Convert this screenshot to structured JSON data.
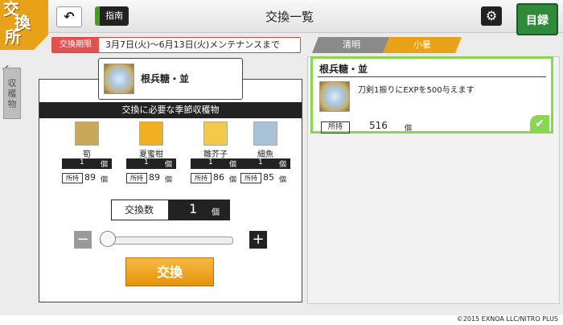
{
  "header": {
    "logo_chars": [
      "交",
      "換",
      "所"
    ],
    "guide_label": "指南",
    "title": "交換一覧",
    "catalog_label": "目録"
  },
  "period": {
    "label": "交換期限",
    "text": "3月7日(火)～6月13日(火)メンテナンスまで"
  },
  "side_tab": {
    "chars": [
      "収",
      "穫",
      "物"
    ]
  },
  "selected": {
    "name": "根兵糖・並",
    "required_header": "交換に必要な季節収穫物"
  },
  "materials": [
    {
      "name": "筍",
      "count": "1",
      "unit": "個",
      "own_label": "所持",
      "own": "89",
      "own_unit": "個",
      "icon_color": "#c9a85a"
    },
    {
      "name": "夏蜜柑",
      "count": "1",
      "unit": "個",
      "own_label": "所持",
      "own": "89",
      "own_unit": "個",
      "icon_color": "#f0b020"
    },
    {
      "name": "雛芥子",
      "count": "1",
      "unit": "個",
      "own_label": "所持",
      "own": "86",
      "own_unit": "個",
      "icon_color": "#f2c94a"
    },
    {
      "name": "細魚",
      "count": "1",
      "unit": "個",
      "own_label": "所持",
      "own": "85",
      "own_unit": "個",
      "icon_color": "#a9c2d8"
    }
  ],
  "quantity": {
    "label": "交換数",
    "value": "1",
    "unit": "個",
    "slider_fraction": 0
  },
  "exchange_button": "交換",
  "seasons": {
    "tabs": [
      {
        "label": "清明",
        "active": false
      },
      {
        "label": "小暑",
        "active": true
      }
    ]
  },
  "item_card": {
    "name": "根兵糖・並",
    "description": "刀剣1振りにEXPを500与えます",
    "own_label": "所持",
    "own": "516",
    "own_unit": "個"
  },
  "copyright": "©2015 EXNOA LLC/NITRO PLUS",
  "colors": {
    "accent_orange": "#e8a21a",
    "accent_green": "#8bd650",
    "period_red": "#e05252"
  }
}
